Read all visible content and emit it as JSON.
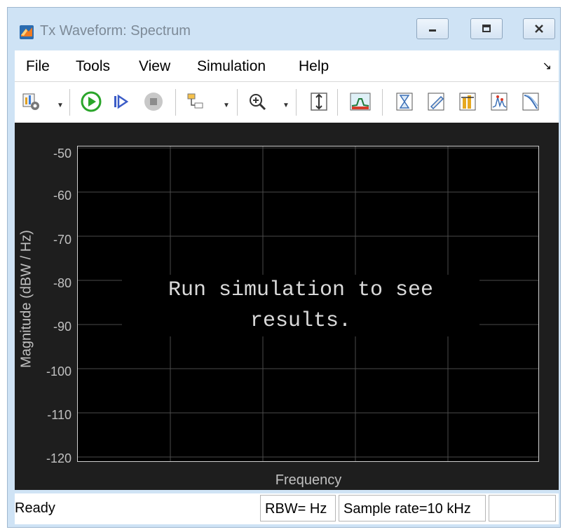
{
  "window": {
    "title": "Tx Waveform: Spectrum",
    "controls": [
      "minimize",
      "maximize",
      "close"
    ]
  },
  "menu": {
    "items": [
      "File",
      "Tools",
      "View",
      "Simulation",
      "Help"
    ],
    "dock_icon": "undock-arrow-icon"
  },
  "toolbar": {
    "buttons": [
      "settings-icon",
      "run-icon",
      "step-forward-icon",
      "stop-icon",
      "signal-selector-icon",
      "zoom-in-icon",
      "scale-axes-icon",
      "spectrum-icon",
      "triggers-icon",
      "measurements-icon",
      "channel-measurements-icon",
      "peak-finder-icon",
      "ccdf-icon"
    ],
    "colors": {
      "run": "#2aa52a",
      "stop": "#8c8c8c"
    }
  },
  "plot": {
    "y_axis_label": "Magnitude (dBW / Hz)",
    "x_axis_label": "Frequency",
    "y_ticks": [
      "-50",
      "-60",
      "-70",
      "-80",
      "-90",
      "-100",
      "-110",
      "-120"
    ],
    "message": "Run simulation to see results.",
    "colors": {
      "background": "#000000",
      "frame": "#1e1e1e",
      "grid": "#4a4a4a",
      "text": "#c0c0c0"
    }
  },
  "status": {
    "state": "Ready",
    "rbw": "RBW= Hz",
    "sample_rate": "Sample rate=10 kHz",
    "extra": ""
  }
}
